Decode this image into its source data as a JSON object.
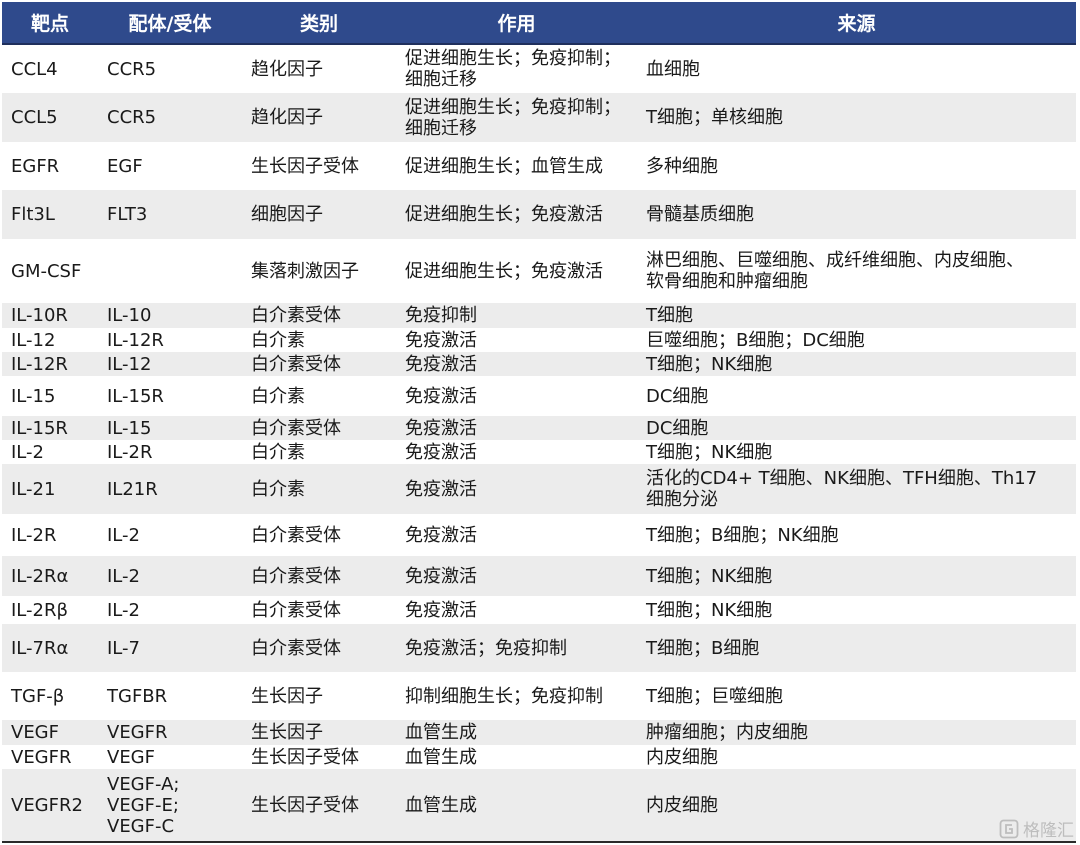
{
  "colors": {
    "header_bg": "#2f4a8c",
    "header_text": "#ffffff",
    "row_alt": "#ececec",
    "watermark": "#bdbdbd"
  },
  "table": {
    "headers": [
      "靶点",
      "配体/受体",
      "类别",
      "作用",
      "来源"
    ],
    "rows": [
      {
        "target": "CCL4",
        "ligand": "CCR5",
        "category": "趋化因子",
        "effect": "促进细胞生长；免疫抑制；\n细胞迁移",
        "source": "血细胞"
      },
      {
        "target": "CCL5",
        "ligand": "CCR5",
        "category": "趋化因子",
        "effect": "促进细胞生长；免疫抑制；\n细胞迁移",
        "source": "T细胞；单核细胞"
      },
      {
        "target": "EGFR",
        "ligand": "EGF",
        "category": "生长因子受体",
        "effect": "促进细胞生长；血管生成",
        "source": "多种细胞"
      },
      {
        "target": "Flt3L",
        "ligand": "FLT3",
        "category": "细胞因子",
        "effect": "促进细胞生长；免疫激活",
        "source": "骨髓基质细胞"
      },
      {
        "target": "GM-CSF",
        "ligand": "",
        "category": "集落刺激因子",
        "effect": "促进细胞生长；免疫激活",
        "source": "淋巴细胞、巨噬细胞、成纤维细胞、内皮细胞、\n软骨细胞和肿瘤细胞"
      },
      {
        "target": "IL-10R",
        "ligand": "IL-10",
        "category": "白介素受体",
        "effect": "免疫抑制",
        "source": "T细胞"
      },
      {
        "target": "IL-12",
        "ligand": "IL-12R",
        "category": "白介素",
        "effect": "免疫激活",
        "source": "巨噬细胞；B细胞；DC细胞"
      },
      {
        "target": "IL-12R",
        "ligand": "IL-12",
        "category": "白介素受体",
        "effect": "免疫激活",
        "source": "T细胞；NK细胞"
      },
      {
        "target": "IL-15",
        "ligand": "IL-15R",
        "category": "白介素",
        "effect": "免疫激活",
        "source": "DC细胞"
      },
      {
        "target": "IL-15R",
        "ligand": "IL-15",
        "category": "白介素受体",
        "effect": "免疫激活",
        "source": "DC细胞"
      },
      {
        "target": "IL-2",
        "ligand": "IL-2R",
        "category": "白介素",
        "effect": "免疫激活",
        "source": "T细胞；NK细胞"
      },
      {
        "target": "IL-21",
        "ligand": "IL21R",
        "category": "白介素",
        "effect": "免疫激活",
        "source": "活化的CD4+ T细胞、NK细胞、TFH细胞、Th17\n细胞分泌"
      },
      {
        "target": "IL-2R",
        "ligand": "IL-2",
        "category": "白介素受体",
        "effect": "免疫激活",
        "source": "T细胞；B细胞；NK细胞"
      },
      {
        "target": "IL-2Rα",
        "ligand": "IL-2",
        "category": "白介素受体",
        "effect": "免疫激活",
        "source": "T细胞；NK细胞"
      },
      {
        "target": "IL-2Rβ",
        "ligand": "IL-2",
        "category": "白介素受体",
        "effect": "免疫激活",
        "source": "T细胞；NK细胞"
      },
      {
        "target": "IL-7Rα",
        "ligand": "IL-7",
        "category": "白介素受体",
        "effect": "免疫激活；免疫抑制",
        "source": "T细胞；B细胞"
      },
      {
        "target": "TGF-β",
        "ligand": "TGFBR",
        "category": "生长因子",
        "effect": "抑制细胞生长；免疫抑制",
        "source": "T细胞；巨噬细胞"
      },
      {
        "target": "VEGF",
        "ligand": "VEGFR",
        "category": "生长因子",
        "effect": "血管生成",
        "source": "肿瘤细胞；内皮细胞"
      },
      {
        "target": "VEGFR",
        "ligand": "VEGF",
        "category": "生长因子受体",
        "effect": "血管生成",
        "source": "内皮细胞"
      },
      {
        "target": "VEGFR2",
        "ligand": "VEGF-A;\nVEGF-E;\nVEGF-C",
        "category": "生长因子受体",
        "effect": "血管生成",
        "source": "内皮细胞"
      }
    ]
  },
  "watermark": {
    "text": "格隆汇",
    "icon": "gelonghui-logo-icon"
  }
}
